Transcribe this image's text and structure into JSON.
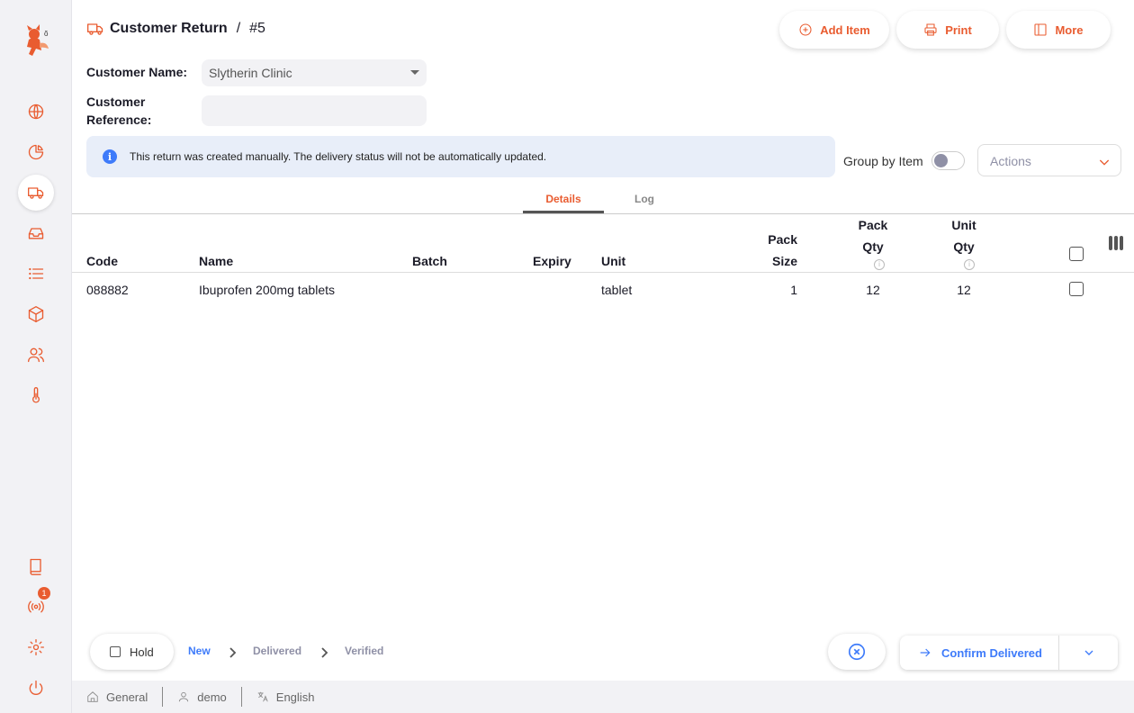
{
  "nav": {
    "items": [
      {
        "icon": "globe-icon"
      },
      {
        "icon": "pie-chart-icon"
      },
      {
        "icon": "truck-icon",
        "active": true
      },
      {
        "icon": "inbox-icon"
      },
      {
        "icon": "list-icon"
      },
      {
        "icon": "package-icon"
      },
      {
        "icon": "users-icon"
      },
      {
        "icon": "thermometer-icon"
      }
    ],
    "bottom_items": [
      {
        "icon": "book-icon"
      },
      {
        "icon": "broadcast-icon",
        "badge": "1"
      },
      {
        "icon": "settings-icon"
      },
      {
        "icon": "power-icon"
      }
    ]
  },
  "header": {
    "title": "Customer Return",
    "separator": "/",
    "number": "#5",
    "buttons": {
      "add_item": "Add Item",
      "print": "Print",
      "more": "More"
    }
  },
  "form": {
    "customer_name_label": "Customer Name:",
    "customer_name_value": "Slytherin Clinic",
    "customer_reference_label": "Customer Reference:",
    "customer_reference_value": ""
  },
  "info_banner": {
    "text": "This return was created manually. The delivery status will not be automatically updated."
  },
  "toolbar": {
    "group_by_item_label": "Group by Item",
    "group_by_item_on": false,
    "actions_placeholder": "Actions"
  },
  "tabs": [
    {
      "label": "Details",
      "active": true
    },
    {
      "label": "Log",
      "active": false
    }
  ],
  "table": {
    "columns": {
      "code": "Code",
      "name": "Name",
      "batch": "Batch",
      "expiry": "Expiry",
      "unit": "Unit",
      "pack_size_1": "Pack",
      "pack_size_2": "Size",
      "pack_qty_1": "Pack",
      "pack_qty_2": "Qty",
      "unit_qty_1": "Unit",
      "unit_qty_2": "Qty"
    },
    "rows": [
      {
        "code": "088882",
        "name": "Ibuprofen 200mg tablets",
        "batch": "",
        "expiry": "",
        "unit": "tablet",
        "pack_size": "1",
        "pack_qty": "12",
        "unit_qty": "12"
      }
    ]
  },
  "footer": {
    "hold_label": "Hold",
    "statuses": [
      "New",
      "Delivered",
      "Verified"
    ],
    "current_status": "New",
    "confirm_label": "Confirm Delivered",
    "store": "General",
    "user": "demo",
    "language": "English"
  },
  "colors": {
    "accent": "#e95c30",
    "primary_blue": "#3e7bfa",
    "sidebar_bg": "#f2f2f5",
    "info_bg": "#e8eef9"
  }
}
